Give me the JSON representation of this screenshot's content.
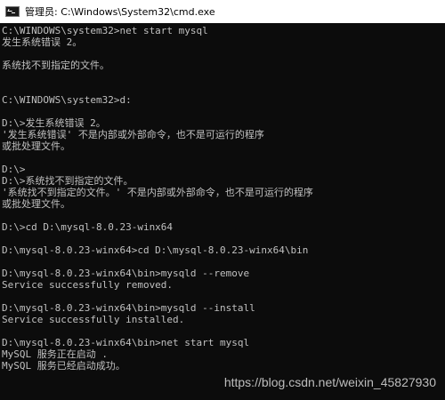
{
  "window": {
    "title": "管理员: C:\\Windows\\System32\\cmd.exe"
  },
  "console": {
    "lines": [
      "C:\\WINDOWS\\system32>net start mysql",
      "发生系统错误 2。",
      "",
      "系统找不到指定的文件。",
      "",
      "",
      "C:\\WINDOWS\\system32>d:",
      "",
      "D:\\>发生系统错误 2。",
      "'发生系统错误' 不是内部或外部命令，也不是可运行的程序",
      "或批处理文件。",
      "",
      "D:\\>",
      "D:\\>系统找不到指定的文件。",
      "'系统找不到指定的文件。' 不是内部或外部命令，也不是可运行的程序",
      "或批处理文件。",
      "",
      "D:\\>cd D:\\mysql-8.0.23-winx64",
      "",
      "D:\\mysql-8.0.23-winx64>cd D:\\mysql-8.0.23-winx64\\bin",
      "",
      "D:\\mysql-8.0.23-winx64\\bin>mysqld --remove",
      "Service successfully removed.",
      "",
      "D:\\mysql-8.0.23-winx64\\bin>mysqld --install",
      "Service successfully installed.",
      "",
      "D:\\mysql-8.0.23-winx64\\bin>net start mysql",
      "MySQL 服务正在启动 .",
      "MySQL 服务已经启动成功。"
    ]
  },
  "watermark": "https://blog.csdn.net/weixin_45827930",
  "colors": {
    "console_background": "#0c0c0c",
    "console_text": "#c0c0c0",
    "titlebar_background": "#ffffff"
  }
}
